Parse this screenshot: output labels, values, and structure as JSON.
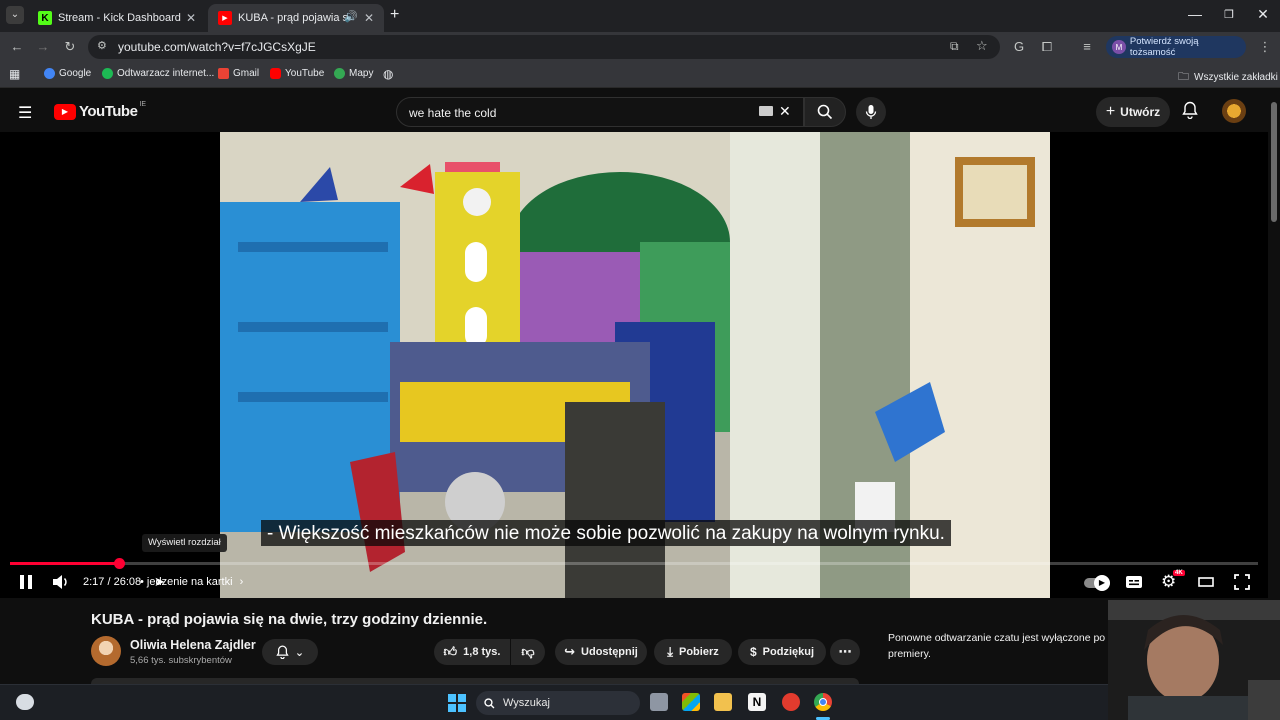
{
  "browser": {
    "tabs": [
      {
        "title": "Stream - Kick Dashboard",
        "favicon": "kick-icon",
        "active": false
      },
      {
        "title": "KUBA - prąd pojawia się na",
        "favicon": "youtube-icon",
        "active": true
      }
    ],
    "url": "youtube.com/watch?v=f7cJGCsXgJE",
    "verify_label": "Potwierdź swoją tożsamość",
    "verify_avatar": "M",
    "bookmarks": [
      {
        "label": "Google",
        "color": "#4285f4"
      },
      {
        "label": "Odtwarzacz internet...",
        "color": "#1db954"
      },
      {
        "label": "Gmail",
        "color": "#ea4335"
      },
      {
        "label": "YouTube",
        "color": "#ff0000"
      },
      {
        "label": "Mapy",
        "color": "#34a853"
      }
    ],
    "all_bookmarks_label": "Wszystkie zakładki"
  },
  "youtube": {
    "logo_text": "YouTube",
    "logo_region": "IE",
    "search_query": "we hate the cold",
    "create_label": "Utwórz"
  },
  "player": {
    "subtitle": "- Większość mieszkańców nie może sobie pozwolić na zakupy na wolnym rynku.",
    "tooltip": "Wyświetl rozdział",
    "time_current": "2:17",
    "time_total": "26:08",
    "chapter": "jedzenie na kartki",
    "progress_fraction": 0.0874,
    "hd_badge": "4K",
    "accent": "#ff0033"
  },
  "video": {
    "title": "KUBA - prąd pojawia się na dwie, trzy godziny dziennie.",
    "channel": "Oliwia Helena Zajdler",
    "subscribers": "5,66 tys. subskrybentów",
    "likes": "1,8 tys.",
    "share_label": "Udostępnij",
    "download_label": "Pobierz",
    "thanks_label": "Podziękuj",
    "chat_note": "Ponowne odtwarzanie czatu jest wyłączone po premiery."
  },
  "taskbar": {
    "search_label": "Wyszukaj"
  }
}
